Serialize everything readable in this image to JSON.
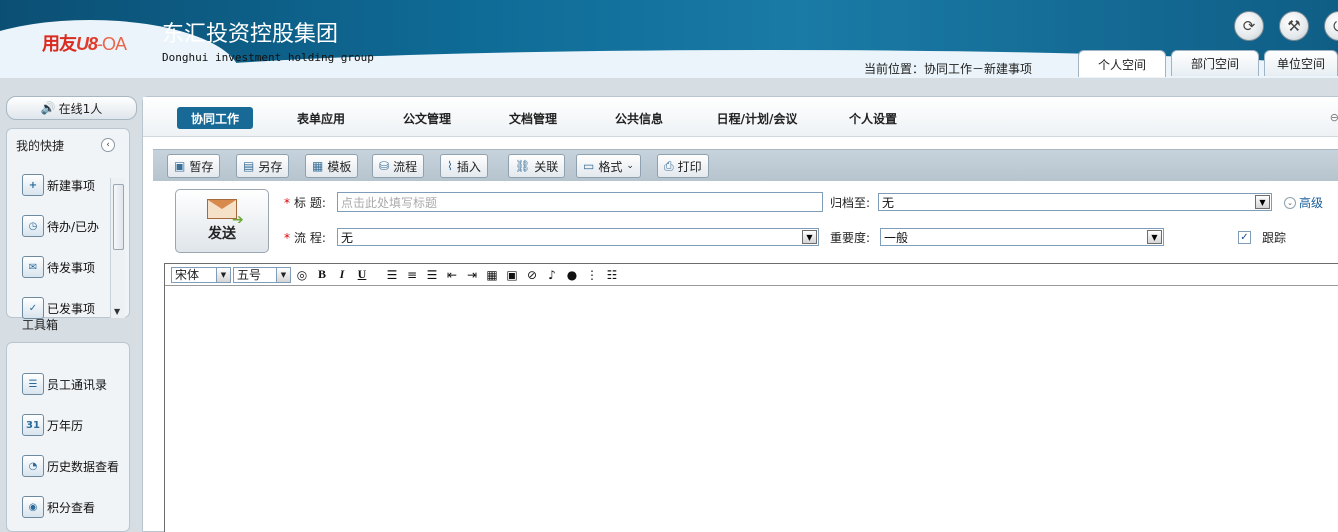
{
  "header": {
    "logo": {
      "brand": "用友",
      "product": "U8",
      "suffix": "-OA"
    },
    "company_name": "东汇投资控股集团",
    "company_name_en": "Donghui investment holding group",
    "location": "当前位置：协同工作－新建事项",
    "icons": [
      "refresh-icon",
      "tools-icon",
      "exit-icon"
    ],
    "space_tabs": [
      "个人空间",
      "部门空间",
      "单位空间"
    ]
  },
  "sidebar": {
    "online": "在线1人",
    "shortcuts_title": "我的快捷",
    "shortcuts": [
      {
        "label": "新建事项",
        "icon": "new-item-icon"
      },
      {
        "label": "待办/已办",
        "icon": "todo-clock-icon"
      },
      {
        "label": "待发事项",
        "icon": "pending-send-icon"
      },
      {
        "label": "已发事项",
        "icon": "sent-items-icon"
      }
    ],
    "toolbox_title": "工具箱",
    "tools": [
      {
        "label": "员工通讯录",
        "icon": "address-book-icon"
      },
      {
        "label": "万年历",
        "icon": "calendar-icon",
        "glyph": "31"
      },
      {
        "label": "历史数据查看",
        "icon": "history-data-icon"
      },
      {
        "label": "积分查看",
        "icon": "points-icon"
      }
    ]
  },
  "menu": {
    "items": [
      "协同工作",
      "表单应用",
      "公文管理",
      "文档管理",
      "公共信息",
      "日程/计划/会议",
      "个人设置"
    ],
    "active": "协同工作"
  },
  "toolbar": {
    "buttons": [
      {
        "label": "暂存",
        "icon": "save-draft-icon"
      },
      {
        "label": "另存",
        "icon": "save-as-icon"
      },
      {
        "label": "模板",
        "icon": "template-icon"
      },
      {
        "label": "流程",
        "icon": "workflow-icon"
      },
      {
        "label": "插入",
        "icon": "paperclip-icon"
      },
      {
        "label": "关联",
        "icon": "link-icon"
      },
      {
        "label": "格式",
        "icon": "format-icon"
      },
      {
        "label": "打印",
        "icon": "print-icon"
      }
    ]
  },
  "form": {
    "send_label": "发送",
    "title_label": "标  题:",
    "title_placeholder": "点击此处填写标题",
    "archive_label": "归档至:",
    "archive_value": "无",
    "advanced_label": "高级",
    "process_label": "流  程:",
    "process_value": "无",
    "importance_label": "重要度:",
    "importance_value": "一般",
    "track_label": "跟踪",
    "track_checked": true
  },
  "editor": {
    "font": "宋体",
    "size": "五号"
  }
}
